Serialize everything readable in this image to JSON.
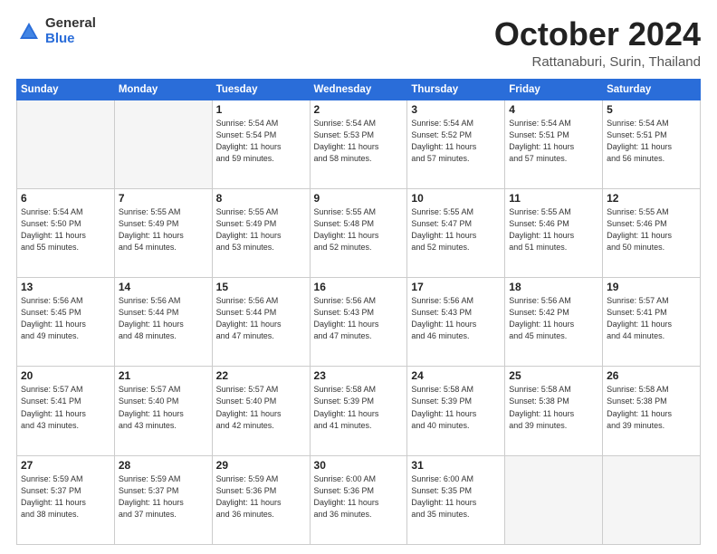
{
  "logo": {
    "general": "General",
    "blue": "Blue"
  },
  "header": {
    "month": "October 2024",
    "location": "Rattanaburi, Surin, Thailand"
  },
  "weekdays": [
    "Sunday",
    "Monday",
    "Tuesday",
    "Wednesday",
    "Thursday",
    "Friday",
    "Saturday"
  ],
  "weeks": [
    [
      {
        "day": "",
        "info": ""
      },
      {
        "day": "",
        "info": ""
      },
      {
        "day": "1",
        "info": "Sunrise: 5:54 AM\nSunset: 5:54 PM\nDaylight: 11 hours\nand 59 minutes."
      },
      {
        "day": "2",
        "info": "Sunrise: 5:54 AM\nSunset: 5:53 PM\nDaylight: 11 hours\nand 58 minutes."
      },
      {
        "day": "3",
        "info": "Sunrise: 5:54 AM\nSunset: 5:52 PM\nDaylight: 11 hours\nand 57 minutes."
      },
      {
        "day": "4",
        "info": "Sunrise: 5:54 AM\nSunset: 5:51 PM\nDaylight: 11 hours\nand 57 minutes."
      },
      {
        "day": "5",
        "info": "Sunrise: 5:54 AM\nSunset: 5:51 PM\nDaylight: 11 hours\nand 56 minutes."
      }
    ],
    [
      {
        "day": "6",
        "info": "Sunrise: 5:54 AM\nSunset: 5:50 PM\nDaylight: 11 hours\nand 55 minutes."
      },
      {
        "day": "7",
        "info": "Sunrise: 5:55 AM\nSunset: 5:49 PM\nDaylight: 11 hours\nand 54 minutes."
      },
      {
        "day": "8",
        "info": "Sunrise: 5:55 AM\nSunset: 5:49 PM\nDaylight: 11 hours\nand 53 minutes."
      },
      {
        "day": "9",
        "info": "Sunrise: 5:55 AM\nSunset: 5:48 PM\nDaylight: 11 hours\nand 52 minutes."
      },
      {
        "day": "10",
        "info": "Sunrise: 5:55 AM\nSunset: 5:47 PM\nDaylight: 11 hours\nand 52 minutes."
      },
      {
        "day": "11",
        "info": "Sunrise: 5:55 AM\nSunset: 5:46 PM\nDaylight: 11 hours\nand 51 minutes."
      },
      {
        "day": "12",
        "info": "Sunrise: 5:55 AM\nSunset: 5:46 PM\nDaylight: 11 hours\nand 50 minutes."
      }
    ],
    [
      {
        "day": "13",
        "info": "Sunrise: 5:56 AM\nSunset: 5:45 PM\nDaylight: 11 hours\nand 49 minutes."
      },
      {
        "day": "14",
        "info": "Sunrise: 5:56 AM\nSunset: 5:44 PM\nDaylight: 11 hours\nand 48 minutes."
      },
      {
        "day": "15",
        "info": "Sunrise: 5:56 AM\nSunset: 5:44 PM\nDaylight: 11 hours\nand 47 minutes."
      },
      {
        "day": "16",
        "info": "Sunrise: 5:56 AM\nSunset: 5:43 PM\nDaylight: 11 hours\nand 47 minutes."
      },
      {
        "day": "17",
        "info": "Sunrise: 5:56 AM\nSunset: 5:43 PM\nDaylight: 11 hours\nand 46 minutes."
      },
      {
        "day": "18",
        "info": "Sunrise: 5:56 AM\nSunset: 5:42 PM\nDaylight: 11 hours\nand 45 minutes."
      },
      {
        "day": "19",
        "info": "Sunrise: 5:57 AM\nSunset: 5:41 PM\nDaylight: 11 hours\nand 44 minutes."
      }
    ],
    [
      {
        "day": "20",
        "info": "Sunrise: 5:57 AM\nSunset: 5:41 PM\nDaylight: 11 hours\nand 43 minutes."
      },
      {
        "day": "21",
        "info": "Sunrise: 5:57 AM\nSunset: 5:40 PM\nDaylight: 11 hours\nand 43 minutes."
      },
      {
        "day": "22",
        "info": "Sunrise: 5:57 AM\nSunset: 5:40 PM\nDaylight: 11 hours\nand 42 minutes."
      },
      {
        "day": "23",
        "info": "Sunrise: 5:58 AM\nSunset: 5:39 PM\nDaylight: 11 hours\nand 41 minutes."
      },
      {
        "day": "24",
        "info": "Sunrise: 5:58 AM\nSunset: 5:39 PM\nDaylight: 11 hours\nand 40 minutes."
      },
      {
        "day": "25",
        "info": "Sunrise: 5:58 AM\nSunset: 5:38 PM\nDaylight: 11 hours\nand 39 minutes."
      },
      {
        "day": "26",
        "info": "Sunrise: 5:58 AM\nSunset: 5:38 PM\nDaylight: 11 hours\nand 39 minutes."
      }
    ],
    [
      {
        "day": "27",
        "info": "Sunrise: 5:59 AM\nSunset: 5:37 PM\nDaylight: 11 hours\nand 38 minutes."
      },
      {
        "day": "28",
        "info": "Sunrise: 5:59 AM\nSunset: 5:37 PM\nDaylight: 11 hours\nand 37 minutes."
      },
      {
        "day": "29",
        "info": "Sunrise: 5:59 AM\nSunset: 5:36 PM\nDaylight: 11 hours\nand 36 minutes."
      },
      {
        "day": "30",
        "info": "Sunrise: 6:00 AM\nSunset: 5:36 PM\nDaylight: 11 hours\nand 36 minutes."
      },
      {
        "day": "31",
        "info": "Sunrise: 6:00 AM\nSunset: 5:35 PM\nDaylight: 11 hours\nand 35 minutes."
      },
      {
        "day": "",
        "info": ""
      },
      {
        "day": "",
        "info": ""
      }
    ]
  ]
}
